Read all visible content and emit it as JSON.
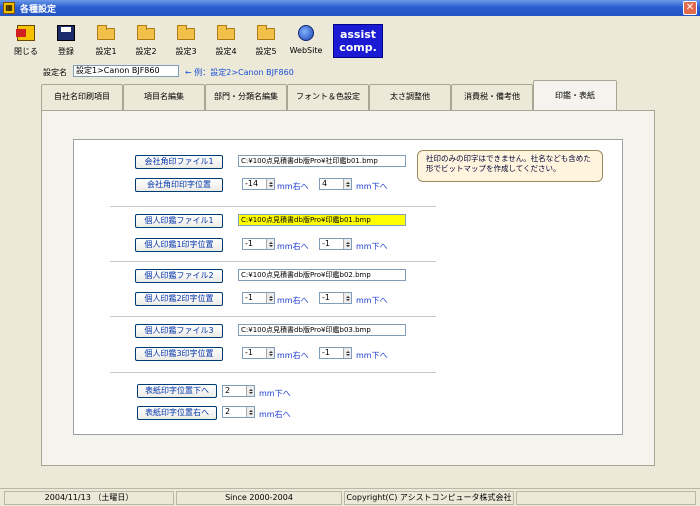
{
  "window": {
    "title": "各種設定",
    "close": "✕"
  },
  "toolbar": {
    "close": "閉じる",
    "save": "登録",
    "s1": "設定1",
    "s2": "設定2",
    "s3": "設定3",
    "s4": "設定4",
    "s5": "設定5",
    "web": "WebSite",
    "assist_line1": "assist",
    "assist_line2": "comp."
  },
  "setting_name": {
    "label": "設定名",
    "value": "設定1>Canon BJF860",
    "hint": "← 例：設定2>Canon BJF860"
  },
  "tabs": [
    "自社名印刷項目",
    "項目名編集",
    "部門・分類名編集",
    "フォント＆色設定",
    "太さ調整他",
    "消費税・備考他",
    "印鑑・表紙"
  ],
  "seal": {
    "company_file_btn": "会社角印ファイル1",
    "company_file": "C:¥100点見積書db版Pro¥社印鑑b01.bmp",
    "company_pos_btn": "会社角印印字位置",
    "company_x": "-14",
    "company_x_unit": "mm右へ",
    "company_y": "4",
    "company_y_unit": "mm下へ",
    "note": "社印のみの印字はできません。社名なども含めた形でビットマップを作成してください。",
    "p1_file_btn": "個人印鑑ファイル1",
    "p1_file": "C:¥100点見積書db版Pro¥印鑑b01.bmp",
    "p1_pos_btn": "個人印鑑1印字位置",
    "p1_x": "-1",
    "p1_x_unit": "mm右へ",
    "p1_y": "-1",
    "p1_y_unit": "mm下へ",
    "p2_file_btn": "個人印鑑ファイル2",
    "p2_file": "C:¥100点見積書db版Pro¥印鑑b02.bmp",
    "p2_pos_btn": "個人印鑑2印字位置",
    "p2_x": "-1",
    "p2_x_unit": "mm右へ",
    "p2_y": "-1",
    "p2_y_unit": "mm下へ",
    "p3_file_btn": "個人印鑑ファイル3",
    "p3_file": "C:¥100点見積書db版Pro¥印鑑b03.bmp",
    "p3_pos_btn": "個人印鑑3印字位置",
    "p3_x": "-1",
    "p3_x_unit": "mm右へ",
    "p3_y": "-1",
    "p3_y_unit": "mm下へ",
    "cover_down_btn": "表紙印字位置下へ",
    "cover_down": "2",
    "cover_down_unit": "mm下へ",
    "cover_right_btn": "表紙印字位置右へ",
    "cover_right": "2",
    "cover_right_unit": "mm右へ"
  },
  "status": {
    "date": "2004/11/13 （土曜日）",
    "since": "Since 2000-2004",
    "copyright": "Copyright(C) アシストコンピュータ株式会社"
  },
  "colors": {
    "title_bar": "#2454c4",
    "highlight_field": "#ffff00",
    "assist_bg": "#1b1bd4"
  }
}
